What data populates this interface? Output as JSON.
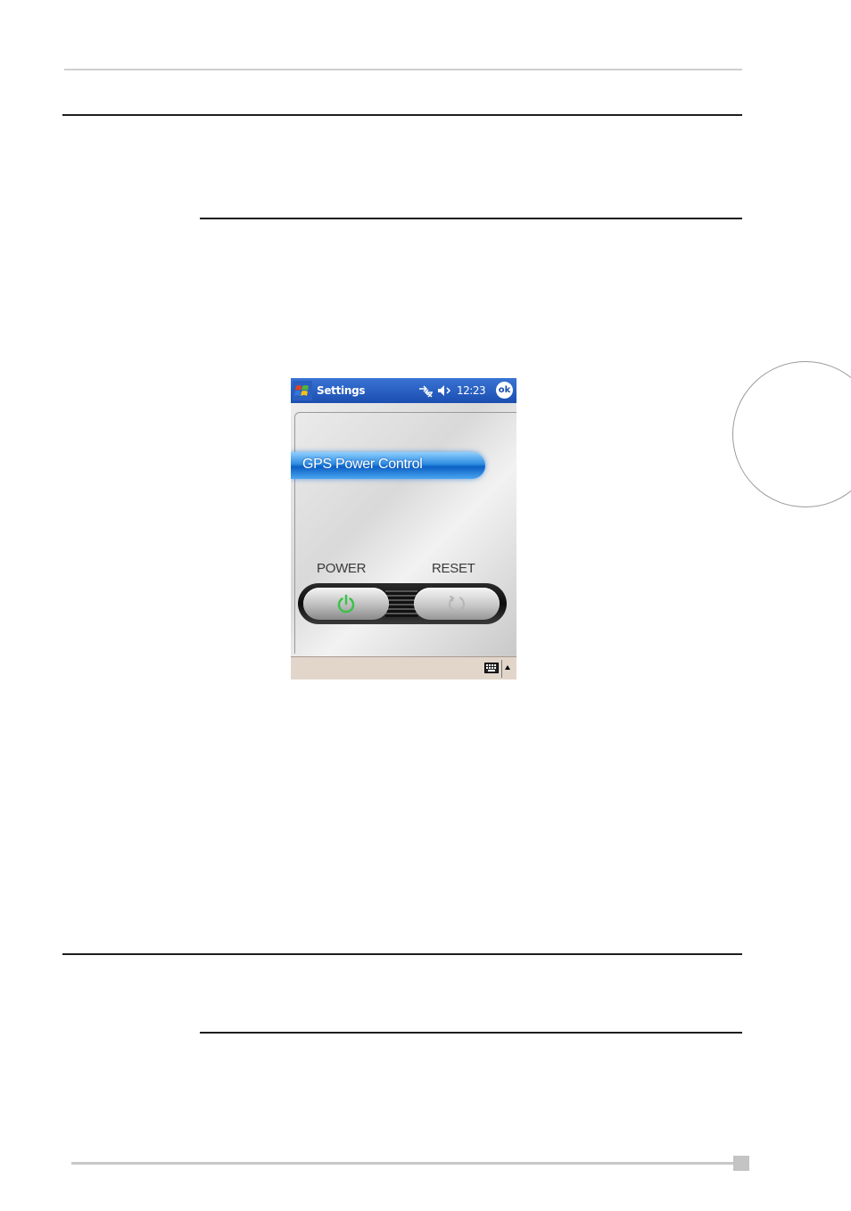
{
  "titlebar": {
    "app_title": "Settings",
    "clock": "12:23",
    "ok_label": "ok",
    "icons": [
      "windows-start-icon",
      "connectivity-icon",
      "volume-muted-icon"
    ]
  },
  "gps": {
    "title": "GPS Power Control",
    "power_label": "POWER",
    "reset_label": "RESET"
  },
  "menubar": {
    "icons": [
      "keyboard-icon",
      "sip-arrow-icon"
    ]
  },
  "colors": {
    "titlebar": "#1a4eb0",
    "banner": "#2d8be0",
    "power_icon": "#3cc24a",
    "menubar": "#e2d6cb"
  }
}
